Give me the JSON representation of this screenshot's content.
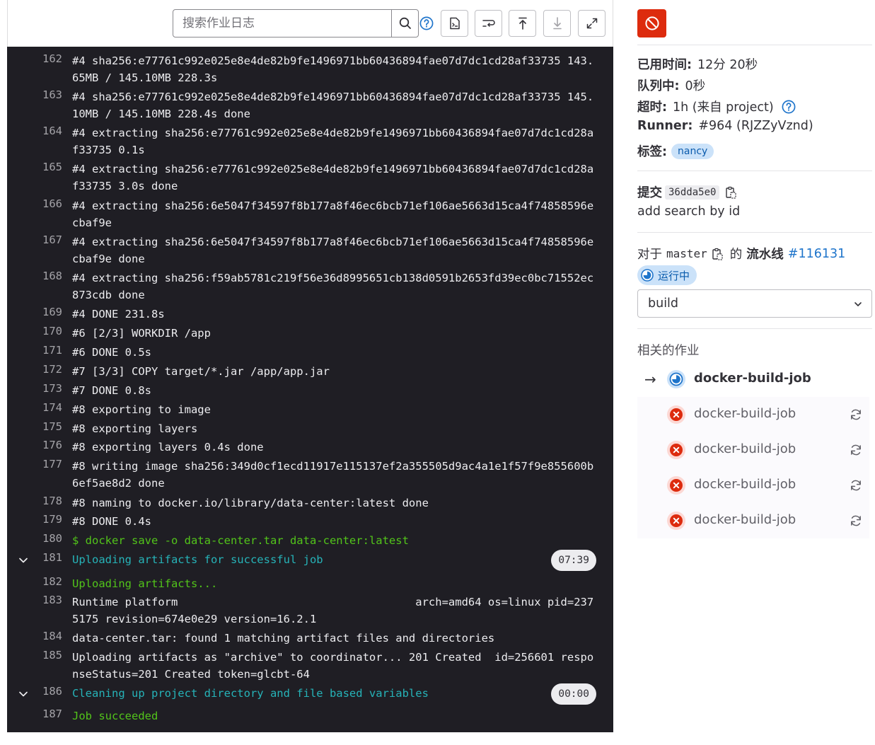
{
  "toolbar": {
    "search_placeholder": "搜索作业日志",
    "icons": [
      "search-icon",
      "help-icon",
      "raw-log-icon",
      "wrap-icon",
      "scroll-top-icon",
      "scroll-bottom-icon",
      "fullscreen-icon"
    ]
  },
  "log": {
    "lines": [
      {
        "n": "162",
        "t": "#4 sha256:e77761c992e025e8e4de82b9fe1496971bb60436894fae07d7dc1cd28af33735 143.65MB / 145.10MB 228.3s",
        "c": ""
      },
      {
        "n": "163",
        "t": "#4 sha256:e77761c992e025e8e4de82b9fe1496971bb60436894fae07d7dc1cd28af33735 145.10MB / 145.10MB 228.4s done",
        "c": ""
      },
      {
        "n": "164",
        "t": "#4 extracting sha256:e77761c992e025e8e4de82b9fe1496971bb60436894fae07d7dc1cd28af33735 0.1s",
        "c": ""
      },
      {
        "n": "165",
        "t": "#4 extracting sha256:e77761c992e025e8e4de82b9fe1496971bb60436894fae07d7dc1cd28af33735 3.0s done",
        "c": ""
      },
      {
        "n": "166",
        "t": "#4 extracting sha256:6e5047f34597f8b177a8f46ec6bcb71ef106ae5663d15ca4f74858596ecbaf9e",
        "c": ""
      },
      {
        "n": "167",
        "t": "#4 extracting sha256:6e5047f34597f8b177a8f46ec6bcb71ef106ae5663d15ca4f74858596ecbaf9e done",
        "c": ""
      },
      {
        "n": "168",
        "t": "#4 extracting sha256:f59ab5781c219f56e36d8995651cb138d0591b2653fd39ec0bc71552ec873cdb done",
        "c": ""
      },
      {
        "n": "169",
        "t": "#4 DONE 231.8s",
        "c": ""
      },
      {
        "n": "170",
        "t": "#6 [2/3] WORKDIR /app",
        "c": ""
      },
      {
        "n": "171",
        "t": "#6 DONE 0.5s",
        "c": ""
      },
      {
        "n": "172",
        "t": "#7 [3/3] COPY target/*.jar /app/app.jar",
        "c": ""
      },
      {
        "n": "173",
        "t": "#7 DONE 0.8s",
        "c": ""
      },
      {
        "n": "174",
        "t": "#8 exporting to image",
        "c": ""
      },
      {
        "n": "175",
        "t": "#8 exporting layers",
        "c": ""
      },
      {
        "n": "176",
        "t": "#8 exporting layers 0.4s done",
        "c": ""
      },
      {
        "n": "177",
        "t": "#8 writing image sha256:349d0cf1ecd11917e115137ef2a355505d9ac4a1e1f57f9e855600b6ef5ae8d2 done",
        "c": ""
      },
      {
        "n": "178",
        "t": "#8 naming to docker.io/library/data-center:latest done",
        "c": ""
      },
      {
        "n": "179",
        "t": "#8 DONE 0.4s",
        "c": ""
      },
      {
        "n": "180",
        "t": "$ docker save -o data-center.tar data-center:latest",
        "c": "green"
      },
      {
        "n": "181",
        "t": "Uploading artifacts for successful job",
        "c": "cyan",
        "section": true,
        "duration": "07:39"
      },
      {
        "n": "182",
        "t": "Uploading artifacts...",
        "c": "green"
      },
      {
        "n": "183",
        "t": "Runtime platform                                    arch=amd64 os=linux pid=2375175 revision=674e0e29 version=16.2.1",
        "c": ""
      },
      {
        "n": "184",
        "t": "data-center.tar: found 1 matching artifact files and directories",
        "c": ""
      },
      {
        "n": "185",
        "t": "Uploading artifacts as \"archive\" to coordinator... 201 Created  id=256601 responseStatus=201 Created token=glcbt-64",
        "c": ""
      },
      {
        "n": "186",
        "t": "Cleaning up project directory and file based variables",
        "c": "cyan",
        "section": true,
        "duration": "00:00"
      },
      {
        "n": "187",
        "t": "Job succeeded",
        "c": "green"
      }
    ]
  },
  "sidebar": {
    "elapsed_label": "已用时间:",
    "elapsed_value": "12分 20秒",
    "queued_label": "队列中:",
    "queued_value": "0秒",
    "timeout_label": "超时:",
    "timeout_value": "1h (来自 project)",
    "runner_label": "Runner:",
    "runner_value": "#964 (RJZZyVznd)",
    "tags_label": "标签:",
    "tag": "nancy",
    "commit_label": "提交",
    "commit_sha": "36dda5e0",
    "commit_message": "add search by id",
    "pipeline_prefix": "对于",
    "pipeline_branch": "master",
    "pipeline_of": "的",
    "pipeline_label": "流水线",
    "pipeline_id": "#116131",
    "pipeline_status": "运行中",
    "stage": "build",
    "related_title": "相关的作业",
    "jobs": [
      {
        "name": "docker-build-job",
        "status": "running",
        "current": true
      },
      {
        "name": "docker-build-job",
        "status": "failed"
      },
      {
        "name": "docker-build-job",
        "status": "failed"
      },
      {
        "name": "docker-build-job",
        "status": "failed"
      },
      {
        "name": "docker-build-job",
        "status": "failed"
      }
    ],
    "colors": {
      "danger": "#dd2b0e",
      "running": "#1f75cb",
      "link": "#1f75cb"
    }
  }
}
